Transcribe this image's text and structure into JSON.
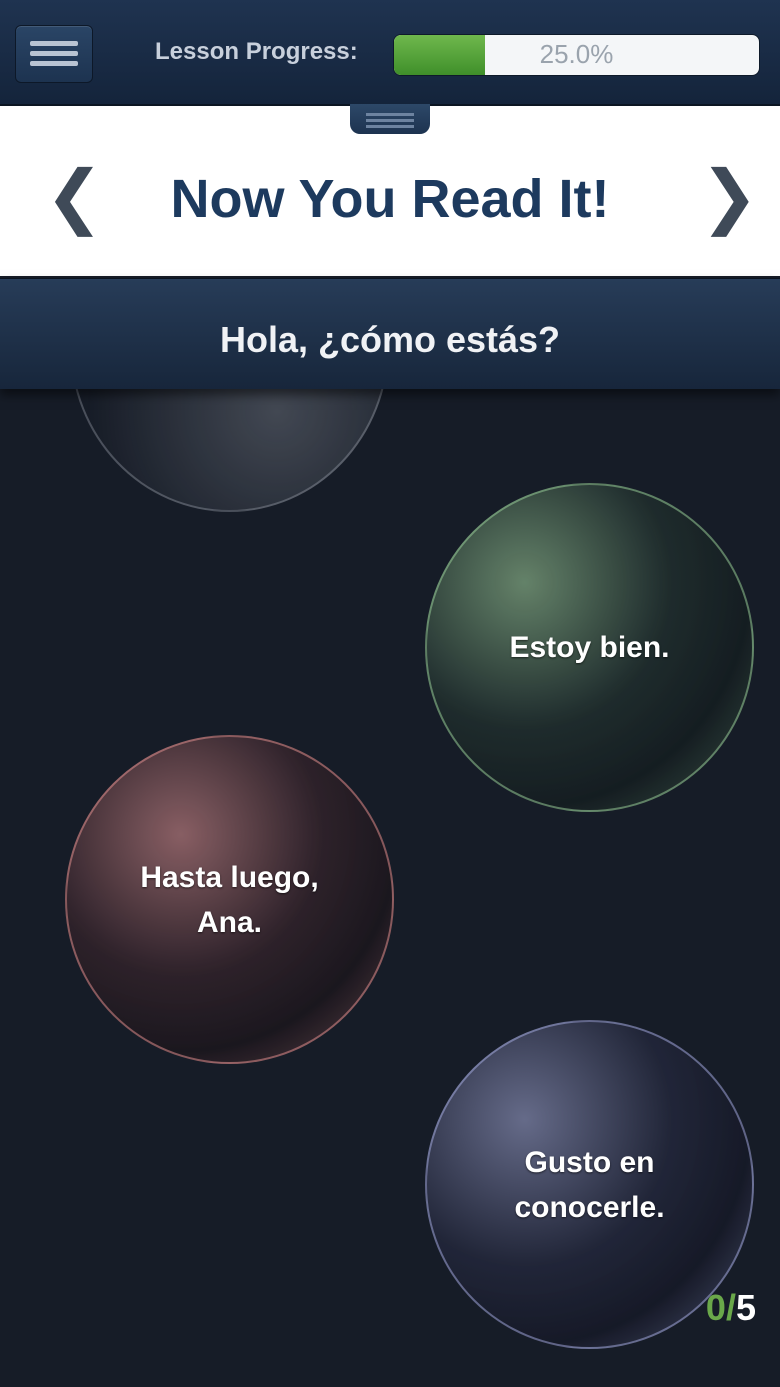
{
  "header": {
    "progress_label": "Lesson Progress:",
    "progress_value": 25.0,
    "progress_text": "25.0%",
    "accent_green": "#4f9e36"
  },
  "title_panel": {
    "prev_arrow": "❮",
    "next_arrow": "❯",
    "title": "Now You Read It!"
  },
  "prompt": {
    "text": "Hola, ¿cómo estás?"
  },
  "bubbles": [
    {
      "text": "",
      "color": "gray"
    },
    {
      "text": "Estoy bien.",
      "color": "green"
    },
    {
      "text": "Hasta luego, Ana.",
      "color": "red"
    },
    {
      "text": "Gusto en conocerle.",
      "color": "blue"
    }
  ],
  "counter": {
    "done": "0",
    "separator": "/",
    "total": "5"
  }
}
